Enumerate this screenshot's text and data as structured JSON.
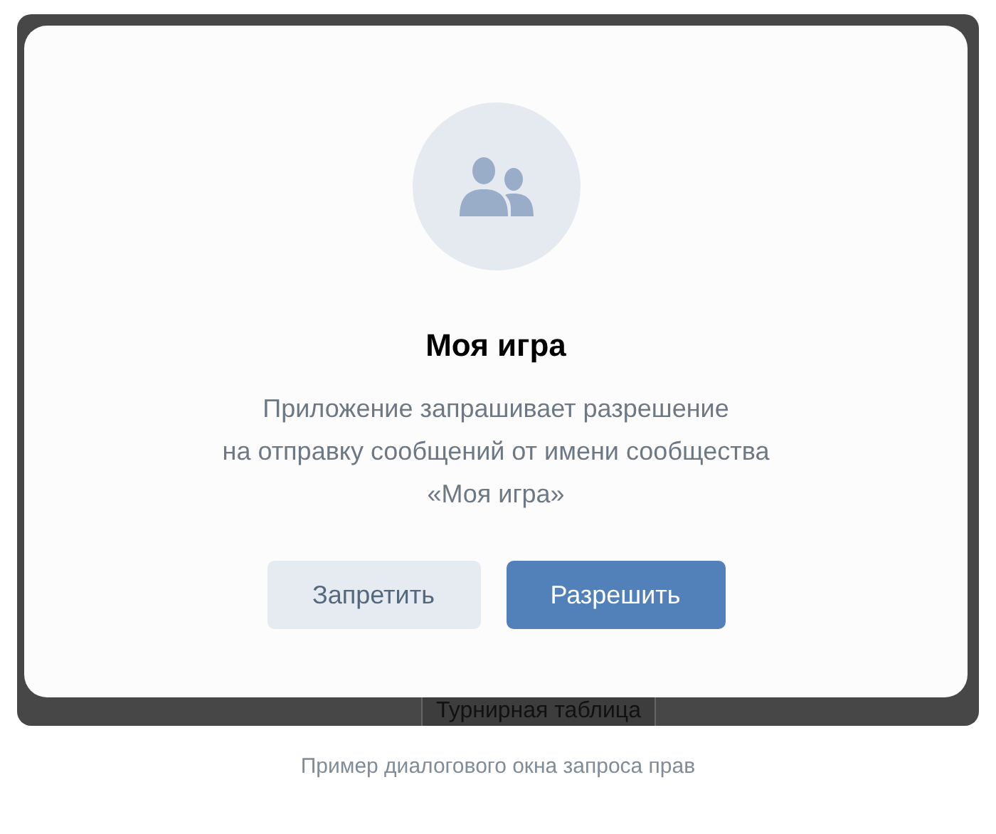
{
  "dialog": {
    "title": "Моя игра",
    "message_lines": [
      "Приложение запрашивает разрешение",
      "на отправку сообщений от имени сообщества",
      "«Моя игра»"
    ],
    "buttons": [
      {
        "label": "Запретить",
        "kind": "secondary"
      },
      {
        "label": "Разрешить",
        "kind": "primary"
      }
    ]
  },
  "background": {
    "tab_label": "Турнирная таблица"
  },
  "caption": "Пример диалогового окна запроса прав"
}
